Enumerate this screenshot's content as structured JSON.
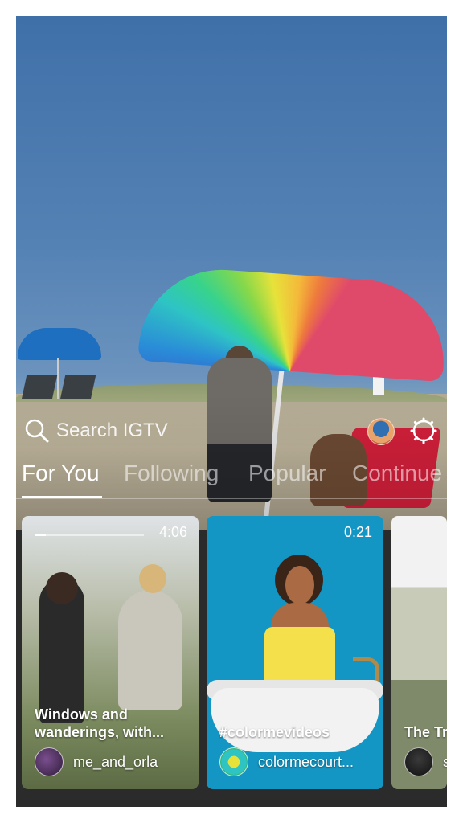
{
  "header": {
    "search_label": "Search IGTV"
  },
  "tabs": [
    {
      "label": "For You",
      "active": true
    },
    {
      "label": "Following",
      "active": false
    },
    {
      "label": "Popular",
      "active": false
    },
    {
      "label": "Continue",
      "active": false
    }
  ],
  "cards": [
    {
      "duration": "4:06",
      "progress": 0.1,
      "title": "Windows and wanderings, with...",
      "username": "me_and_orla"
    },
    {
      "duration": "0:21",
      "title": "#colormevideos",
      "username": "colormecourt..."
    },
    {
      "title": "The Tr",
      "username": "s"
    }
  ],
  "icons": {
    "search": "search-icon",
    "settings": "gear-icon"
  }
}
